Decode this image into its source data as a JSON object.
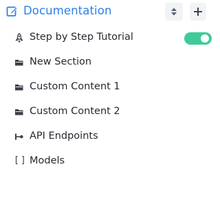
{
  "header": {
    "title": "Documentation",
    "doc_icon": "edit-document-icon",
    "sort_icon": "sort-icon",
    "add_icon": "plus-icon"
  },
  "items": [
    {
      "label": "Step by Step Tutorial",
      "icon": "rocket-icon",
      "toggle": "on"
    },
    {
      "label": "New Section",
      "icon": "folder-icon"
    },
    {
      "label": "Custom Content 1",
      "icon": "folder-icon"
    },
    {
      "label": "Custom Content 2",
      "icon": "folder-icon"
    },
    {
      "label": "API Endpoints",
      "icon": "endpoint-icon"
    },
    {
      "label": "Models",
      "icon": "brackets-icon",
      "glyph": "[]"
    }
  ],
  "colors": {
    "accent": "#2a80e8",
    "toggle_on": "#3ecb97"
  }
}
